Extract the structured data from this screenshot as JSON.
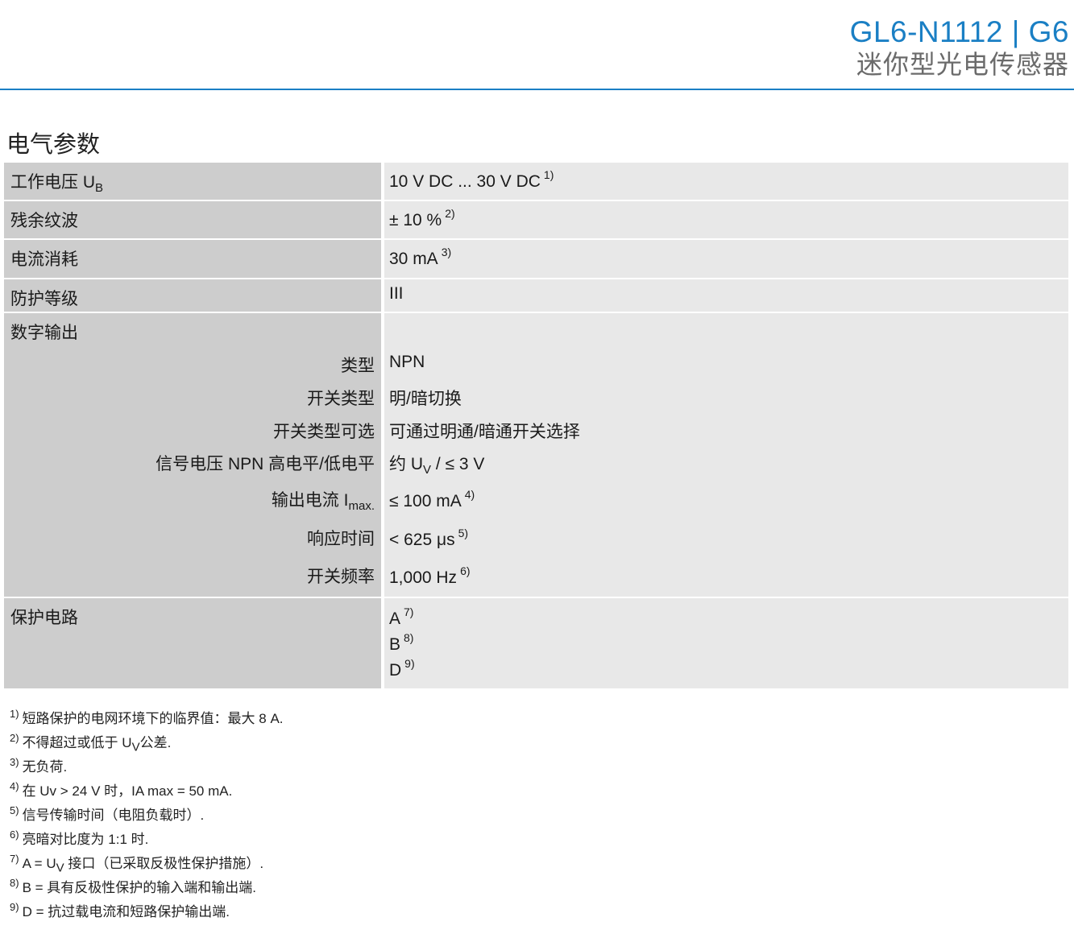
{
  "header": {
    "title": "GL6-N1112 | G6",
    "subtitle": "迷你型光电传感器"
  },
  "section_title": "电气参数",
  "rows": {
    "ub": {
      "label": "工作电压 U",
      "label_sub": "B",
      "value": "10 V DC ... 30 V DC",
      "note": "1)"
    },
    "ripple": {
      "label": "残余纹波",
      "value": "± 10 %",
      "note": "2)"
    },
    "current": {
      "label": "电流消耗",
      "value": "30 mA",
      "note": "3)"
    },
    "protection_class": {
      "label": "防护等级",
      "value": "III"
    },
    "digital_output": {
      "label": "数字输出"
    },
    "type": {
      "label": "类型",
      "value": "NPN"
    },
    "switching_type": {
      "label": "开关类型",
      "value": "明/暗切换"
    },
    "switching_option": {
      "label": "开关类型可选",
      "value": "可通过明通/暗通开关选择"
    },
    "signal_voltage": {
      "label": "信号电压 NPN 高电平/低电平",
      "value_pre": "约 U",
      "value_sub": "V",
      "value_post": " / ≤ 3 V"
    },
    "output_current": {
      "label": "输出电流 I",
      "label_sub": "max.",
      "value": "≤ 100 mA",
      "note": "4)"
    },
    "response_time": {
      "label": "响应时间",
      "value": "< 625 μs",
      "note": "5)"
    },
    "switching_freq": {
      "label": "开关频率",
      "value": "1,000 Hz",
      "note": "6)"
    },
    "protective_circuits": {
      "label": "保护电路",
      "items": [
        {
          "value": "A",
          "note": "7)"
        },
        {
          "value": "B",
          "note": "8)"
        },
        {
          "value": "D",
          "note": "9)"
        }
      ]
    }
  },
  "footnotes": [
    {
      "num": "1)",
      "text": "短路保护的电网环境下的临界值：最大 8 A."
    },
    {
      "num": "2)",
      "text_pre": "不得超过或低于 U",
      "text_sub": "V",
      "text_post": "公差."
    },
    {
      "num": "3)",
      "text": "无负荷."
    },
    {
      "num": "4)",
      "text": "在 Uv > 24 V 时，IA max = 50 mA."
    },
    {
      "num": "5)",
      "text": "信号传输时间（电阻负载时）."
    },
    {
      "num": "6)",
      "text": "亮暗对比度为 1:1 时."
    },
    {
      "num": "7)",
      "text_pre": "A = U",
      "text_sub": "V",
      "text_post": " 接口（已采取反极性保护措施）."
    },
    {
      "num": "8)",
      "text": "B = 具有反极性保护的输入端和输出端."
    },
    {
      "num": "9)",
      "text": "D = 抗过载电流和短路保护输出端."
    }
  ]
}
